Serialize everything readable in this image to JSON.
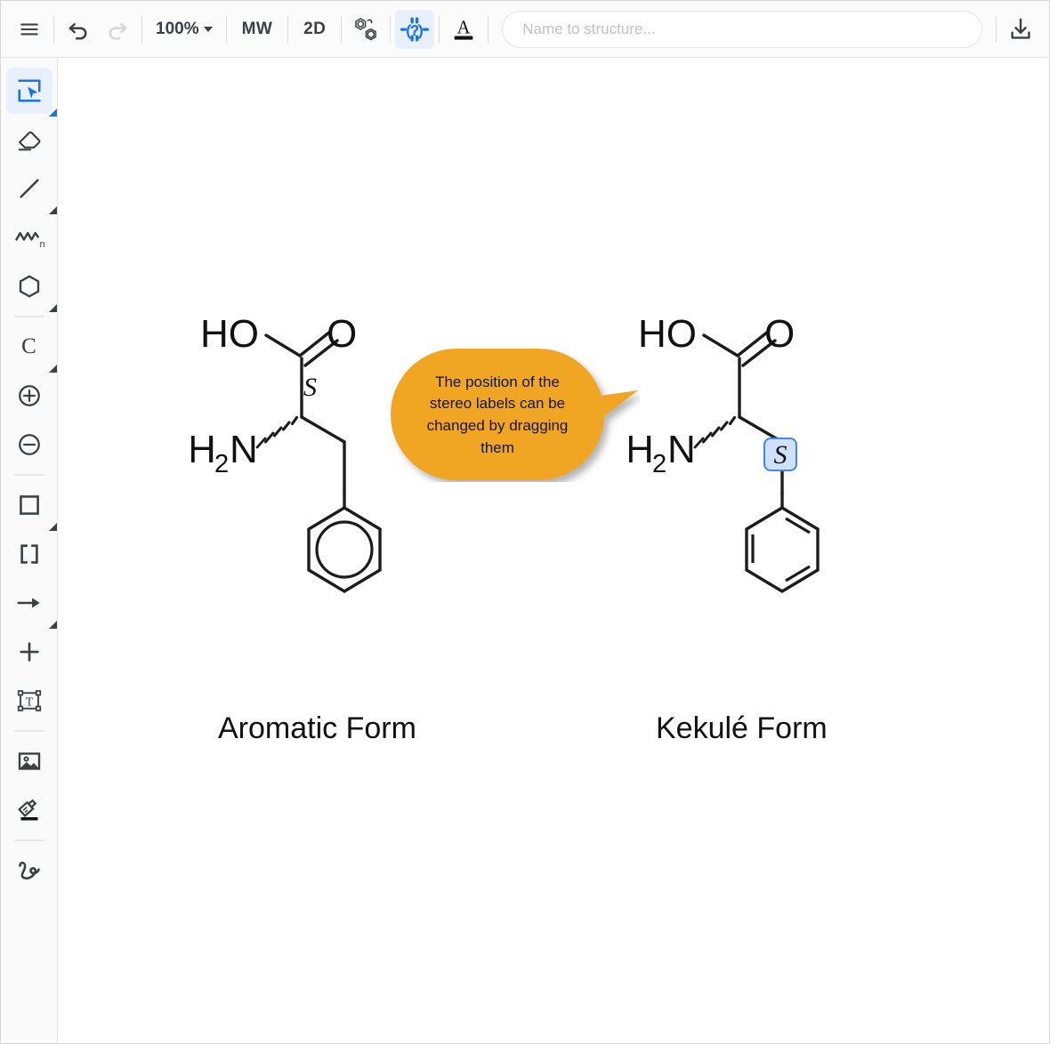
{
  "app": {
    "title": "Chemical Structure Editor",
    "accent_color": "#1a73e8",
    "callout_color": "#f0a623"
  },
  "toolbar": {
    "menu_label": "Menu",
    "undo_label": "Undo",
    "redo_label": "Redo",
    "zoom_level": "100%",
    "mw_label": "MW",
    "two_d_label": "2D",
    "aromatize_label": "Aromatize / Kekulize",
    "stereo_flag_label": "Add/Remove explicit stereo flags",
    "text_color_label": "Text color",
    "download_label": "Download",
    "items": [
      {
        "name": "hamburger-menu",
        "label": "Menu",
        "type": "icon"
      },
      {
        "name": "undo",
        "label": "Undo",
        "type": "icon",
        "enabled": true
      },
      {
        "name": "redo",
        "label": "Redo",
        "type": "icon",
        "enabled": false
      },
      {
        "name": "zoom",
        "label": "100%",
        "type": "dropdown"
      },
      {
        "name": "mw",
        "label": "MW",
        "type": "text"
      },
      {
        "name": "2d",
        "label": "2D",
        "type": "text"
      },
      {
        "name": "aromatize",
        "label": "Aromatize / Kekulize",
        "type": "icon"
      },
      {
        "name": "stereo-flag",
        "label": "Stereo flags",
        "type": "icon",
        "active": true
      },
      {
        "name": "text-color",
        "label": "Text color",
        "type": "icon"
      },
      {
        "name": "download",
        "label": "Download",
        "type": "icon"
      }
    ]
  },
  "search": {
    "placeholder": "Name to structure...",
    "value": ""
  },
  "sidebar": {
    "items": [
      {
        "name": "select-tool",
        "label": "Selection tool",
        "icon": "cursor-select-icon",
        "active": true,
        "has_submenu": true
      },
      {
        "name": "eraser-tool",
        "label": "Eraser",
        "icon": "eraser-icon",
        "active": false,
        "has_submenu": false
      },
      {
        "name": "bond-tool",
        "label": "Bond",
        "icon": "bond-line-icon",
        "active": false,
        "has_submenu": true
      },
      {
        "name": "chain-tool",
        "label": "Chain",
        "icon": "chain-zigzag-icon",
        "active": false,
        "has_submenu": false
      },
      {
        "name": "ring-tool",
        "label": "Ring",
        "icon": "hexagon-icon",
        "active": false,
        "has_submenu": true
      },
      {
        "name": "atom-carbon-tool",
        "label": "C",
        "icon": "carbon-atom-icon",
        "active": false,
        "has_submenu": true
      },
      {
        "name": "charge-plus-tool",
        "label": "Increase charge",
        "icon": "circle-plus-icon",
        "active": false,
        "has_submenu": false
      },
      {
        "name": "charge-minus-tool",
        "label": "Decrease charge",
        "icon": "circle-minus-icon",
        "active": false,
        "has_submenu": false
      },
      {
        "name": "shape-tool",
        "label": "Shape",
        "icon": "square-icon",
        "active": false,
        "has_submenu": true
      },
      {
        "name": "bracket-tool",
        "label": "Brackets",
        "icon": "brackets-icon",
        "active": false,
        "has_submenu": false
      },
      {
        "name": "arrow-tool",
        "label": "Reaction arrow",
        "icon": "arrow-right-icon",
        "active": false,
        "has_submenu": true
      },
      {
        "name": "plus-tool",
        "label": "Reaction plus",
        "icon": "plus-icon",
        "active": false,
        "has_submenu": false
      },
      {
        "name": "text-tool",
        "label": "Text box",
        "icon": "text-box-icon",
        "active": false,
        "has_submenu": false
      },
      {
        "name": "image-tool",
        "label": "Insert image",
        "icon": "image-icon",
        "active": false,
        "has_submenu": false
      },
      {
        "name": "format-painter",
        "label": "Format painter",
        "icon": "paint-format-icon",
        "active": false,
        "has_submenu": false
      },
      {
        "name": "freehand-tool",
        "label": "Freehand",
        "icon": "freehand-icon",
        "active": false,
        "has_submenu": false
      }
    ]
  },
  "canvas": {
    "structures": [
      {
        "id": "aromatic",
        "caption": "Aromatic Form",
        "molecule": "Phenylalanine",
        "ring_style": "aromatic-circle",
        "atom_labels": [
          "HO",
          "O",
          "H",
          "2",
          "N"
        ],
        "stereo_label": "S",
        "stereo_selected": false
      },
      {
        "id": "kekule",
        "caption": "Kekulé Form",
        "molecule": "Phenylalanine",
        "ring_style": "kekule-double-bonds",
        "atom_labels": [
          "HO",
          "O",
          "H",
          "2",
          "N"
        ],
        "stereo_label": "S",
        "stereo_selected": true
      }
    ],
    "labels": {
      "hydroxyl": "HO",
      "oxygen": "O",
      "amine_h": "H",
      "amine_sub": "2",
      "amine_n": "N",
      "stereo": "S"
    },
    "callout": {
      "text": "The position of the stereo labels can be changed by dragging them",
      "background": "#f0a623",
      "text_color": "#151515"
    }
  }
}
